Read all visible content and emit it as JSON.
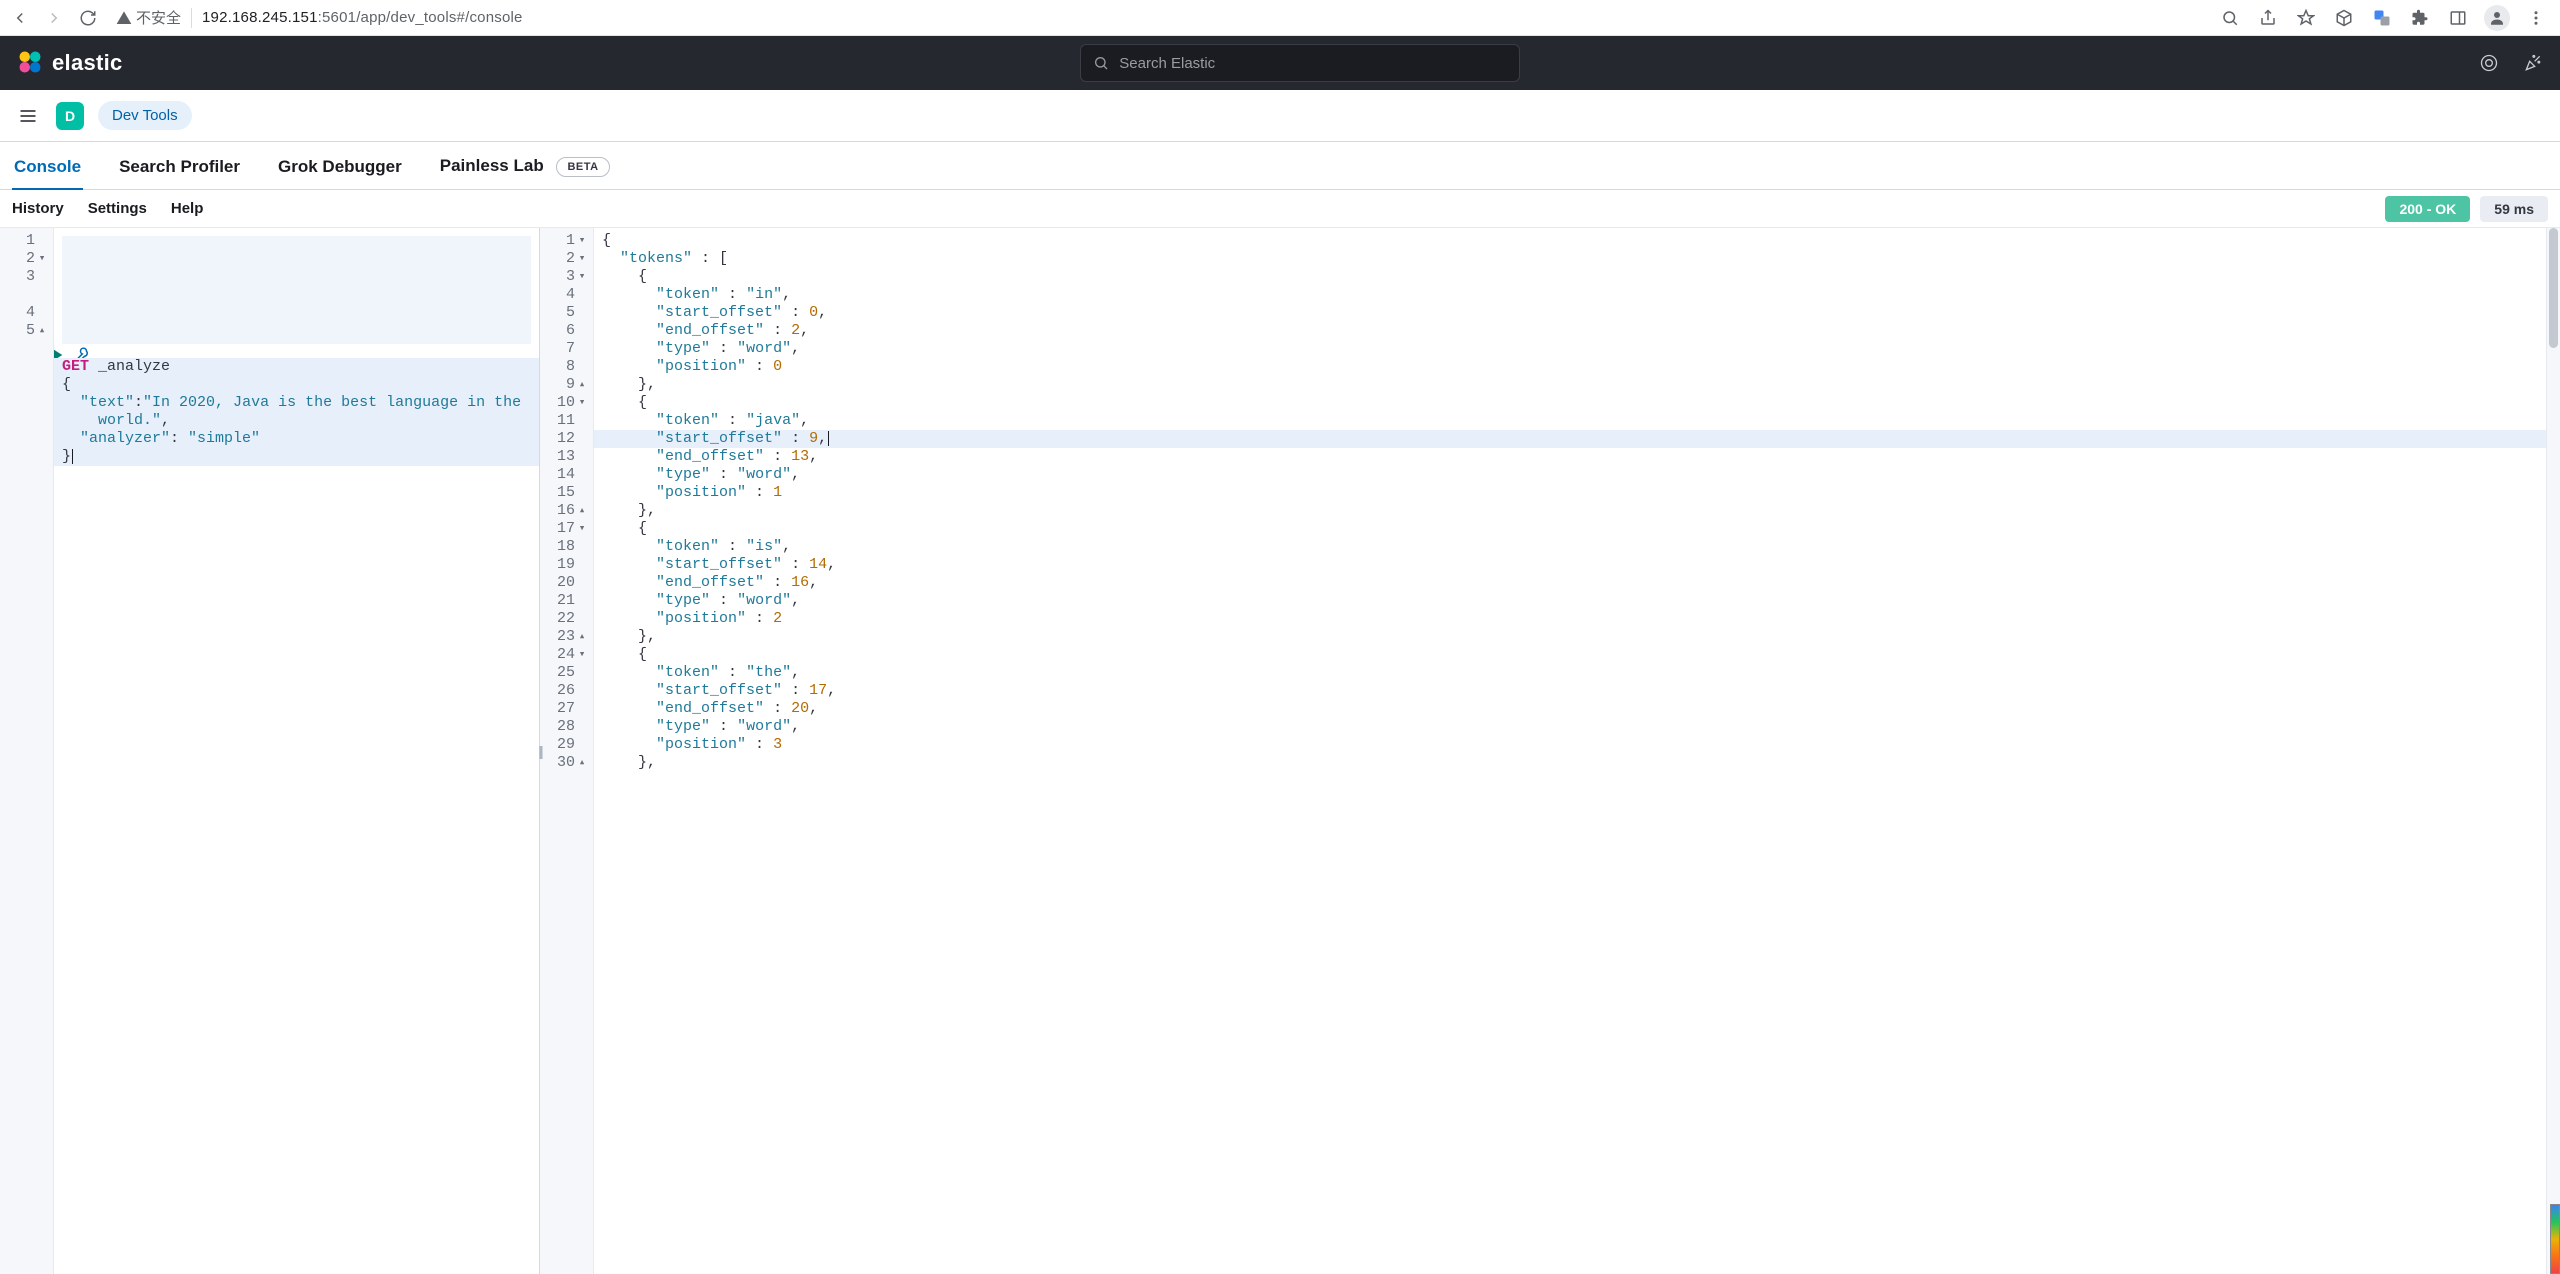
{
  "browser": {
    "security_label": "不安全",
    "url_host": "192.168.245.151",
    "url_port": ":5601",
    "url_path": "/app/dev_tools#/console"
  },
  "kibana": {
    "search_placeholder": "Search Elastic",
    "space_letter": "D",
    "breadcrumb": "Dev Tools",
    "tabs": {
      "console": "Console",
      "search_profiler": "Search Profiler",
      "grok": "Grok Debugger",
      "painless": "Painless Lab",
      "beta": "BETA"
    },
    "toolbar": {
      "history": "History",
      "settings": "Settings",
      "help": "Help",
      "status": "200 - OK",
      "latency": "59 ms"
    }
  },
  "request": {
    "lines": [
      {
        "n": "1",
        "fold": "",
        "content_html": "<span class=\"tok-method\">GET</span> <span class=\"tok-plain\">_analyze</span>",
        "hl": true
      },
      {
        "n": "2",
        "fold": "▾",
        "content_html": "<span class=\"tok-punc\">{</span>",
        "hl": true
      },
      {
        "n": "3",
        "fold": "",
        "content_html": "  <span class=\"tok-key\">\"text\"</span><span class=\"tok-punc\">:</span><span class=\"tok-str\">\"In 2020, Java is the best language in the</span>",
        "hl": true
      },
      {
        "n": "",
        "fold": "",
        "content_html": "    <span class=\"tok-str\">world.\"</span><span class=\"tok-punc\">,</span>",
        "hl": true
      },
      {
        "n": "4",
        "fold": "",
        "content_html": "  <span class=\"tok-key\">\"analyzer\"</span><span class=\"tok-punc\">: </span><span class=\"tok-str\">\"simple\"</span>",
        "hl": true
      },
      {
        "n": "5",
        "fold": "▴",
        "content_html": "<span class=\"tok-punc\">}</span><span class=\"cursor-bar\"></span>",
        "hl": true
      }
    ]
  },
  "response": {
    "lines": [
      {
        "n": "1",
        "fold": "▾",
        "content_html": "<span class=\"tok-punc\">{</span>"
      },
      {
        "n": "2",
        "fold": "▾",
        "content_html": "  <span class=\"tok-key\">\"tokens\"</span> <span class=\"tok-punc\">: [</span>"
      },
      {
        "n": "3",
        "fold": "▾",
        "content_html": "    <span class=\"tok-punc\">{</span>"
      },
      {
        "n": "4",
        "fold": "",
        "content_html": "      <span class=\"tok-key\">\"token\"</span> <span class=\"tok-punc\">:</span> <span class=\"tok-str\">\"in\"</span><span class=\"tok-punc\">,</span>"
      },
      {
        "n": "5",
        "fold": "",
        "content_html": "      <span class=\"tok-key\">\"start_offset\"</span> <span class=\"tok-punc\">:</span> <span class=\"tok-num\">0</span><span class=\"tok-punc\">,</span>"
      },
      {
        "n": "6",
        "fold": "",
        "content_html": "      <span class=\"tok-key\">\"end_offset\"</span> <span class=\"tok-punc\">:</span> <span class=\"tok-num\">2</span><span class=\"tok-punc\">,</span>"
      },
      {
        "n": "7",
        "fold": "",
        "content_html": "      <span class=\"tok-key\">\"type\"</span> <span class=\"tok-punc\">:</span> <span class=\"tok-str\">\"word\"</span><span class=\"tok-punc\">,</span>"
      },
      {
        "n": "8",
        "fold": "",
        "content_html": "      <span class=\"tok-key\">\"position\"</span> <span class=\"tok-punc\">:</span> <span class=\"tok-num\">0</span>"
      },
      {
        "n": "9",
        "fold": "▴",
        "content_html": "    <span class=\"tok-punc\">},</span>"
      },
      {
        "n": "10",
        "fold": "▾",
        "content_html": "    <span class=\"tok-punc\">{</span>"
      },
      {
        "n": "11",
        "fold": "",
        "content_html": "      <span class=\"tok-key\">\"token\"</span> <span class=\"tok-punc\">:</span> <span class=\"tok-str\">\"java\"</span><span class=\"tok-punc\">,</span>"
      },
      {
        "n": "12",
        "fold": "",
        "content_html": "      <span class=\"tok-key\">\"start_offset\"</span> <span class=\"tok-punc\">:</span> <span class=\"tok-num\">9</span><span class=\"tok-punc\">,</span><span class=\"cursor-bar\"></span>",
        "hl": true
      },
      {
        "n": "13",
        "fold": "",
        "content_html": "      <span class=\"tok-key\">\"end_offset\"</span> <span class=\"tok-punc\">:</span> <span class=\"tok-num\">13</span><span class=\"tok-punc\">,</span>"
      },
      {
        "n": "14",
        "fold": "",
        "content_html": "      <span class=\"tok-key\">\"type\"</span> <span class=\"tok-punc\">:</span> <span class=\"tok-str\">\"word\"</span><span class=\"tok-punc\">,</span>"
      },
      {
        "n": "15",
        "fold": "",
        "content_html": "      <span class=\"tok-key\">\"position\"</span> <span class=\"tok-punc\">:</span> <span class=\"tok-num\">1</span>"
      },
      {
        "n": "16",
        "fold": "▴",
        "content_html": "    <span class=\"tok-punc\">},</span>"
      },
      {
        "n": "17",
        "fold": "▾",
        "content_html": "    <span class=\"tok-punc\">{</span>"
      },
      {
        "n": "18",
        "fold": "",
        "content_html": "      <span class=\"tok-key\">\"token\"</span> <span class=\"tok-punc\">:</span> <span class=\"tok-str\">\"is\"</span><span class=\"tok-punc\">,</span>"
      },
      {
        "n": "19",
        "fold": "",
        "content_html": "      <span class=\"tok-key\">\"start_offset\"</span> <span class=\"tok-punc\">:</span> <span class=\"tok-num\">14</span><span class=\"tok-punc\">,</span>"
      },
      {
        "n": "20",
        "fold": "",
        "content_html": "      <span class=\"tok-key\">\"end_offset\"</span> <span class=\"tok-punc\">:</span> <span class=\"tok-num\">16</span><span class=\"tok-punc\">,</span>"
      },
      {
        "n": "21",
        "fold": "",
        "content_html": "      <span class=\"tok-key\">\"type\"</span> <span class=\"tok-punc\">:</span> <span class=\"tok-str\">\"word\"</span><span class=\"tok-punc\">,</span>"
      },
      {
        "n": "22",
        "fold": "",
        "content_html": "      <span class=\"tok-key\">\"position\"</span> <span class=\"tok-punc\">:</span> <span class=\"tok-num\">2</span>"
      },
      {
        "n": "23",
        "fold": "▴",
        "content_html": "    <span class=\"tok-punc\">},</span>"
      },
      {
        "n": "24",
        "fold": "▾",
        "content_html": "    <span class=\"tok-punc\">{</span>"
      },
      {
        "n": "25",
        "fold": "",
        "content_html": "      <span class=\"tok-key\">\"token\"</span> <span class=\"tok-punc\">:</span> <span class=\"tok-str\">\"the\"</span><span class=\"tok-punc\">,</span>"
      },
      {
        "n": "26",
        "fold": "",
        "content_html": "      <span class=\"tok-key\">\"start_offset\"</span> <span class=\"tok-punc\">:</span> <span class=\"tok-num\">17</span><span class=\"tok-punc\">,</span>"
      },
      {
        "n": "27",
        "fold": "",
        "content_html": "      <span class=\"tok-key\">\"end_offset\"</span> <span class=\"tok-punc\">:</span> <span class=\"tok-num\">20</span><span class=\"tok-punc\">,</span>"
      },
      {
        "n": "28",
        "fold": "",
        "content_html": "      <span class=\"tok-key\">\"type\"</span> <span class=\"tok-punc\">:</span> <span class=\"tok-str\">\"word\"</span><span class=\"tok-punc\">,</span>"
      },
      {
        "n": "29",
        "fold": "",
        "content_html": "      <span class=\"tok-key\">\"position\"</span> <span class=\"tok-punc\">:</span> <span class=\"tok-num\">3</span>"
      },
      {
        "n": "30",
        "fold": "▴",
        "content_html": "    <span class=\"tok-punc\">},</span>"
      }
    ]
  }
}
